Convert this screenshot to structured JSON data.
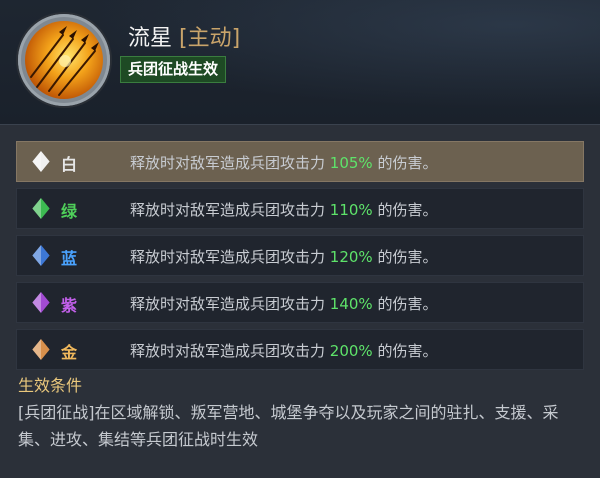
{
  "skill": {
    "name": "流星",
    "type_label": "[主动]",
    "tag": "兵团征战生效"
  },
  "tiers": [
    {
      "name": "白",
      "color": "#e6e6e6",
      "gem": "white-gem-icon",
      "gem_color": "#f0f0f0",
      "desc_prefix": "释放时对敌军造成兵团攻击力 ",
      "value": "105%",
      "desc_suffix": " 的伤害。",
      "active": true
    },
    {
      "name": "绿",
      "color": "#4fd05a",
      "gem": "green-gem-icon",
      "gem_color": "#3dbb52",
      "desc_prefix": "释放时对敌军造成兵团攻击力 ",
      "value": "110%",
      "desc_suffix": " 的伤害。",
      "active": false
    },
    {
      "name": "蓝",
      "color": "#4aa3ff",
      "gem": "blue-gem-icon",
      "gem_color": "#3d78d6",
      "desc_prefix": "释放时对敌军造成兵团攻击力 ",
      "value": "120%",
      "desc_suffix": " 的伤害。",
      "active": false
    },
    {
      "name": "紫",
      "color": "#c260ea",
      "gem": "purple-gem-icon",
      "gem_color": "#a24bd3",
      "desc_prefix": "释放时对敌军造成兵团攻击力 ",
      "value": "140%",
      "desc_suffix": " 的伤害。",
      "active": false
    },
    {
      "name": "金",
      "color": "#f0b85c",
      "gem": "gold-gem-icon",
      "gem_color": "#d8904c",
      "desc_prefix": "释放时对敌军造成兵团攻击力 ",
      "value": "200%",
      "desc_suffix": " 的伤害。",
      "active": false
    }
  ],
  "conditions": {
    "title": "生效条件",
    "text": "[兵团征战]在区域解锁、叛军营地、城堡争夺以及玩家之间的驻扎、支援、采集、进攻、集结等兵团征战时生效"
  },
  "colors": {
    "accent_gold": "#e9c77c",
    "value_green": "#5ee36a",
    "tag_green": "#1e4a24"
  }
}
